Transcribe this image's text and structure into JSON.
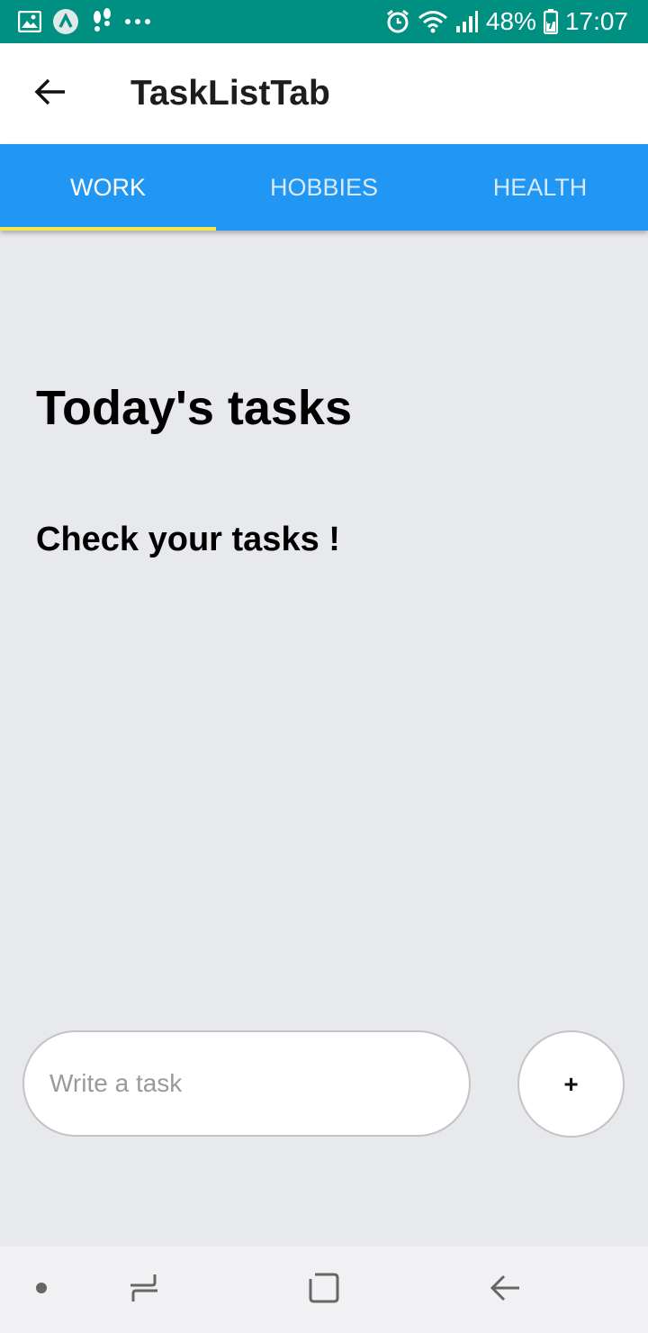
{
  "status_bar": {
    "left_icons": [
      "gallery-icon",
      "app-a-icon",
      "footsteps-icon",
      "more-dots-icon"
    ],
    "battery": "48%",
    "time": "17:07",
    "right_icons": [
      "alarm-icon",
      "wifi-icon",
      "signal-icon",
      "battery-icon"
    ],
    "background": "#009081"
  },
  "app_bar": {
    "title": "TaskListTab",
    "back_icon": "arrow-left-icon"
  },
  "tabs": [
    {
      "label": "WORK",
      "active": true
    },
    {
      "label": "HOBBIES",
      "active": false
    },
    {
      "label": "HEALTH",
      "active": false
    }
  ],
  "tab_colors": {
    "background": "#2196f3",
    "indicator": "#f4e84a"
  },
  "content": {
    "heading": "Today's tasks",
    "subheading": "Check your tasks !"
  },
  "task_input": {
    "placeholder": "Write a task",
    "value": ""
  },
  "add_button": {
    "label": "+"
  },
  "nav_bar": {
    "icons": [
      "dot-icon",
      "recent-apps-icon",
      "home-icon",
      "back-icon"
    ]
  }
}
